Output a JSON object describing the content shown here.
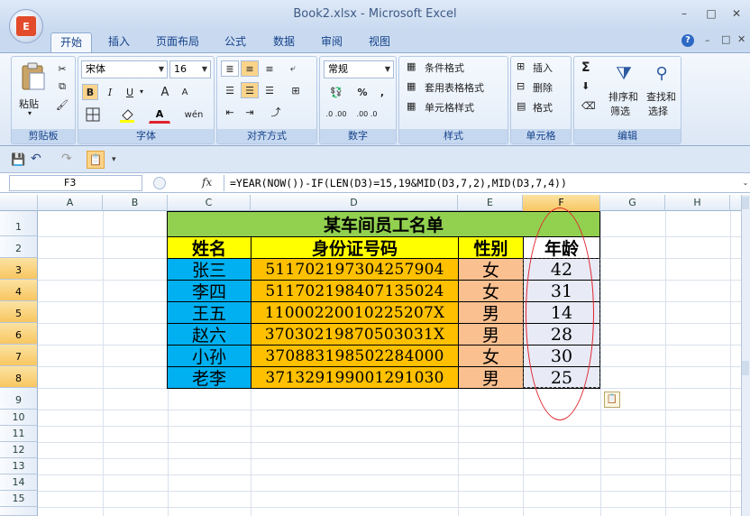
{
  "window": {
    "title": "Book2.xlsx - Microsoft Excel",
    "office_button_letter": "E",
    "minimize_glyph": "–",
    "maximize_glyph": "□",
    "close_glyph": "✕"
  },
  "tabs": [
    "开始",
    "插入",
    "页面布局",
    "公式",
    "数据",
    "审阅",
    "视图"
  ],
  "ribbon": {
    "clipboard": {
      "label": "剪贴板",
      "paste": "粘贴"
    },
    "font": {
      "label": "字体",
      "font_name": "宋体",
      "font_size": "16",
      "bold": "B",
      "italic": "I",
      "underline": "U",
      "grow": "A",
      "shrink": "A",
      "font_color_letter": "A",
      "phonetic": "wén"
    },
    "alignment": {
      "label": "对齐方式"
    },
    "number": {
      "label": "数字",
      "format": "常规",
      "percent": "%",
      "comma": ",",
      "inc_decimal": ".0 .00",
      "dec_decimal": ".00 .0"
    },
    "styles": {
      "label": "样式",
      "conditional": "条件格式",
      "table_format": "套用表格格式",
      "cell_styles": "单元格样式"
    },
    "cells": {
      "label": "单元格",
      "insert": "插入",
      "delete": "删除",
      "format": "格式"
    },
    "editing": {
      "label": "编辑",
      "sum": "Σ",
      "sort_filter": "排序和\n筛选",
      "sort_label_1": "排序和",
      "sort_label_2": "筛选",
      "find_label_1": "查找和",
      "find_label_2": "选择"
    }
  },
  "formula_bar": {
    "name_box": "F3",
    "fx": "fx",
    "formula": "=YEAR(NOW())-IF(LEN(D3)=15,19&MID(D3,7,2),MID(D3,7,4))"
  },
  "columns": [
    "A",
    "B",
    "C",
    "D",
    "E",
    "F",
    "G",
    "H"
  ],
  "rows": [
    "1",
    "2",
    "3",
    "4",
    "5",
    "6",
    "7",
    "8",
    "9",
    "10",
    "11",
    "12",
    "13",
    "14",
    "15"
  ],
  "table": {
    "title": "某车间员工名单",
    "headers": [
      "姓名",
      "身份证号码",
      "性别",
      "年龄"
    ],
    "records": [
      {
        "name": "张三",
        "id": "511702197304257904",
        "gender": "女",
        "age": "42"
      },
      {
        "name": "李四",
        "id": "511702198407135024",
        "gender": "女",
        "age": "31"
      },
      {
        "name": "王五",
        "id": "110002200102252​07X",
        "gender": "男",
        "age": "14"
      },
      {
        "name": "赵六",
        "id": "37030219870503031X",
        "gender": "男",
        "age": "28"
      },
      {
        "name": "小孙",
        "id": "370883198502284000",
        "gender": "女",
        "age": "30"
      },
      {
        "name": "老李",
        "id": "371329199001291030",
        "gender": "男",
        "age": "25"
      }
    ]
  },
  "colors": {
    "title_fill": "#92d050",
    "header_fill": "#ffff00",
    "name_fill": "#00b0f0",
    "id_fill": "#ffc000",
    "gender_fill": "#fac090",
    "age_fill": "#e8eaf6",
    "annotation_oval": "#e0232b",
    "selected_header": "#f8c660"
  }
}
